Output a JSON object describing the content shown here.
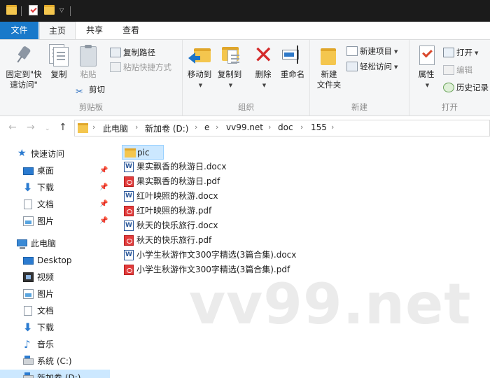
{
  "quick_access_toolbar": {
    "icons": [
      "folder-icon",
      "properties-icon",
      "new-folder-icon",
      "customize-dropdown-icon"
    ]
  },
  "tabs": {
    "file": "文件",
    "home": "主页",
    "share": "共享",
    "view": "查看"
  },
  "ribbon": {
    "clipboard": {
      "label": "剪贴板",
      "pin_line1": "固定到\"快",
      "pin_line2": "速访问\"",
      "copy": "复制",
      "paste": "粘贴",
      "copy_path": "复制路径",
      "paste_shortcut": "粘贴快捷方式",
      "cut": "剪切"
    },
    "organize": {
      "label": "组织",
      "move_to": "移动到",
      "copy_to": "复制到",
      "delete": "删除",
      "rename": "重命名"
    },
    "new": {
      "label": "新建",
      "new_folder_line1": "新建",
      "new_folder_line2": "文件夹",
      "new_item": "新建项目",
      "easy_access": "轻松访问"
    },
    "open": {
      "label": "打开",
      "properties": "属性",
      "open": "打开",
      "edit": "编辑",
      "history": "历史记录"
    }
  },
  "address": {
    "breadcrumbs": [
      "此电脑",
      "新加卷 (D:)",
      "e",
      "vv99.net",
      "doc",
      "155"
    ]
  },
  "nav": {
    "quick_access": "快速访问",
    "desktop_cn": "桌面",
    "downloads": "下载",
    "documents": "文档",
    "pictures": "图片",
    "this_pc": "此电脑",
    "desktop": "Desktop",
    "videos": "视频",
    "pictures2": "图片",
    "documents2": "文档",
    "downloads2": "下载",
    "music": "音乐",
    "drive_c": "系统 (C:)",
    "drive_d": "新加卷 (D:)"
  },
  "files": [
    {
      "name": "pic",
      "type": "folder"
    },
    {
      "name": "果实飘香的秋游日.docx",
      "type": "word"
    },
    {
      "name": "果实飘香的秋游日.pdf",
      "type": "pdf"
    },
    {
      "name": "红叶映照的秋游.docx",
      "type": "word"
    },
    {
      "name": "红叶映照的秋游.pdf",
      "type": "pdf"
    },
    {
      "name": "秋天的快乐旅行.docx",
      "type": "word"
    },
    {
      "name": "秋天的快乐旅行.pdf",
      "type": "pdf"
    },
    {
      "name": "小学生秋游作文300字精选(3篇合集).docx",
      "type": "word"
    },
    {
      "name": "小学生秋游作文300字精选(3篇合集).pdf",
      "type": "pdf"
    }
  ],
  "watermark": "vv99.net",
  "colors": {
    "accent": "#1979ca",
    "selection": "#cce8ff",
    "folder": "#f4c64e"
  }
}
